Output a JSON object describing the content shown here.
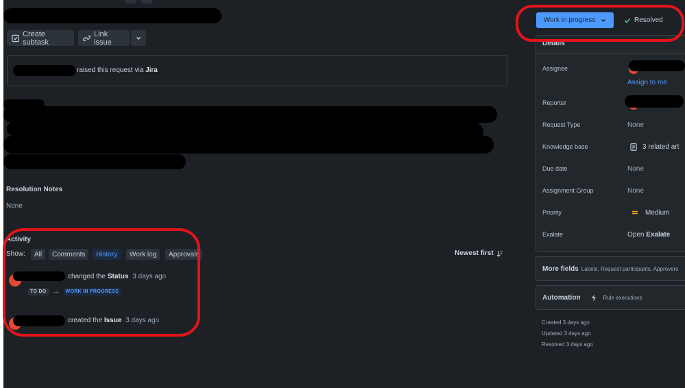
{
  "toolbar": {
    "create_subtask": "Create subtask",
    "link_issue": "Link issue"
  },
  "request_banner": {
    "text": "raised this request via",
    "source": "Jira"
  },
  "resolution": {
    "title": "Resolution Notes",
    "value": "None"
  },
  "activity": {
    "title": "Activity",
    "show_label": "Show:",
    "tabs": [
      "All",
      "Comments",
      "History",
      "Work log",
      "Approvals"
    ],
    "active_tab": "History",
    "sort_label": "Newest first",
    "items": [
      {
        "action_prefix": "changed the",
        "field": "Status",
        "time": "3 days ago",
        "from_status": "TO DO",
        "arrow": "→",
        "to_status": "WORK IN PROGRESS"
      },
      {
        "action_prefix": "created the",
        "field": "Issue",
        "time": "3 days ago"
      }
    ]
  },
  "status": {
    "current": "Work in progress",
    "transition": "Resolved"
  },
  "details": {
    "title": "Details",
    "assignee_label": "Assignee",
    "assign_to_me": "Assign to me",
    "reporter_label": "Reporter",
    "request_type_label": "Request Type",
    "request_type_value": "None",
    "knowledge_base_label": "Knowledge base",
    "knowledge_base_value": "3 related art",
    "due_date_label": "Due date",
    "due_date_value": "None",
    "assignment_group_label": "Assignment Group",
    "assignment_group_value": "None",
    "priority_label": "Priority",
    "priority_value": "Medium",
    "exalate_label": "Exalate",
    "exalate_open": "Open",
    "exalate_value": "Exalate"
  },
  "more_fields": {
    "title": "More fields",
    "subtitle": "Labels, Request participants, Approvers"
  },
  "automation": {
    "title": "Automation",
    "subtitle": "Rule executions"
  },
  "timestamps": {
    "created": "Created 3 days ago",
    "updated": "Updated 3 days ago",
    "resolved": "Resolved 3 days ago"
  },
  "colors": {
    "background": "#1d2125",
    "accent": "#579dff",
    "status_button": "#4c9aff",
    "resolved_check": "#4bce97",
    "priority_medium": "#f5a623",
    "annotation_red": "#e3141b"
  }
}
